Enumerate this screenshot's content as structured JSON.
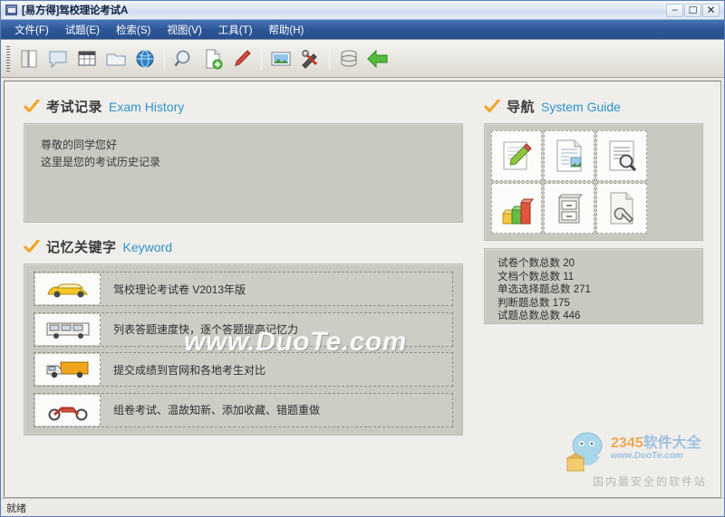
{
  "window": {
    "title": "[易方得]驾校理论考试A",
    "app_icon": "app-icon",
    "minimize_label": "–",
    "maximize_label": "☐",
    "close_label": "✕"
  },
  "menu": {
    "items": [
      {
        "label": "文件(F)",
        "name": "menu-file"
      },
      {
        "label": "试题(E)",
        "name": "menu-questions"
      },
      {
        "label": "检索(S)",
        "name": "menu-search"
      },
      {
        "label": "视图(V)",
        "name": "menu-view"
      },
      {
        "label": "工具(T)",
        "name": "menu-tools"
      },
      {
        "label": "帮助(H)",
        "name": "menu-help"
      }
    ]
  },
  "toolbar": {
    "icons": [
      "book-icon",
      "speech-bubble-icon",
      "table-icon",
      "folder-icon",
      "globe-icon",
      "magnifier-icon",
      "new-document-icon",
      "pen-icon",
      "picture-icon",
      "tools-icon",
      "database-icon",
      "back-arrow-icon"
    ]
  },
  "exam_history": {
    "title_cn": "考试记录",
    "title_en": "Exam History",
    "lines": [
      "尊敬的同学您好",
      "这里是您的考试历史记录"
    ]
  },
  "keyword": {
    "title_cn": "记忆关键字",
    "title_en": "Keyword",
    "rows": [
      {
        "icon": "taxi-car-icon",
        "text": "驾校理论考试卷  V2013年版"
      },
      {
        "icon": "bus-icon",
        "text": "列表答题速度快，逐个答题提高记忆力"
      },
      {
        "icon": "truck-icon",
        "text": "提交成绩到官网和各地考生对比"
      },
      {
        "icon": "motorcycle-icon",
        "text": "组卷考试、温故知新、添加收藏、错题重做"
      }
    ]
  },
  "system_guide": {
    "title_cn": "导航",
    "title_en": "System Guide",
    "tiles": [
      "edit-pencil-icon",
      "document-image-icon",
      "document-search-icon",
      "bar-chart-icon",
      "file-cabinet-icon",
      "document-wrench-icon"
    ]
  },
  "stats": {
    "lines": [
      "试卷个数总数  20",
      "文档个数总数  11",
      "单选选择题总数  271",
      "判断题总数  175",
      "试题总数总数  446"
    ]
  },
  "watermark": {
    "duote": "www.DuoTe.com",
    "brand_num": "2345",
    "brand_text": "软件大全",
    "brand_url": "www.DuoTe.com",
    "tagline": "国内最安全的软件站"
  },
  "statusbar": {
    "text": "就绪"
  },
  "colors": {
    "accent_blue": "#2f93c7",
    "check_orange": "#f0a51e",
    "menu_blue": "#2e5798",
    "panel_grey": "#c9c9c1"
  }
}
